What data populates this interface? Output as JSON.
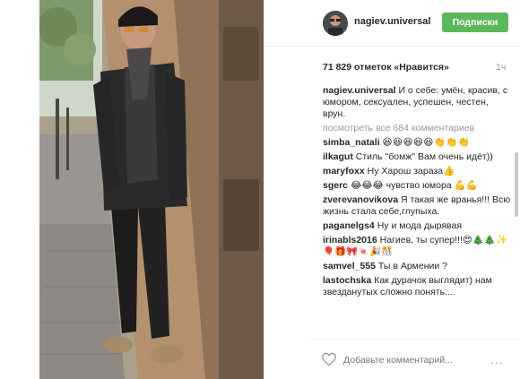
{
  "post": {
    "username": "nagiev.universal",
    "follow_label": "Подписки",
    "likes_text": "71 829 отметок «Нравится»",
    "time_ago": "1ч",
    "caption_user": "nagiev.universal",
    "caption_text": "И о себе: умён, красив, с юмором, сексуален, успешен, честен, врун.",
    "view_all_comments": "посмотреть все 684 комментариев",
    "add_comment_placeholder": "Добавьте комментарий...",
    "more_dots": "..."
  },
  "comments": [
    {
      "user": "simba_natali",
      "text": "😆😆😆😆😆👏👏👏"
    },
    {
      "user": "ilkagut",
      "text": "Стиль \"бомж\" Вам очень идёт))"
    },
    {
      "user": "maryfoxx",
      "text": "Ну Харош зараза👍"
    },
    {
      "user": "sgerc",
      "text": "😂😂😂 чувство юмора 💪💪"
    },
    {
      "user": "zverevanovikova",
      "text": "Я такая же вранья!!! Всю жизнь стала себе,глупыха."
    },
    {
      "user": "paganelgs4",
      "text": "Ну и мода дырявая"
    },
    {
      "user": "irinabls2016",
      "text": "Нагиев, ты супер!!!😍🎄🎄✨🎈🎁🎀🍬🎉🎊"
    },
    {
      "user": "samvel_555",
      "text": "Ты в Армении ?"
    },
    {
      "user": "lastochska",
      "text": "Как дурачок выглядит) нам звезданутых сложно понять...."
    }
  ],
  "icons": {
    "heart": "heart-icon",
    "more": "more-options-icon"
  },
  "colors": {
    "follow_button": "#5cb85c",
    "text": "#262626",
    "muted": "#999999"
  }
}
